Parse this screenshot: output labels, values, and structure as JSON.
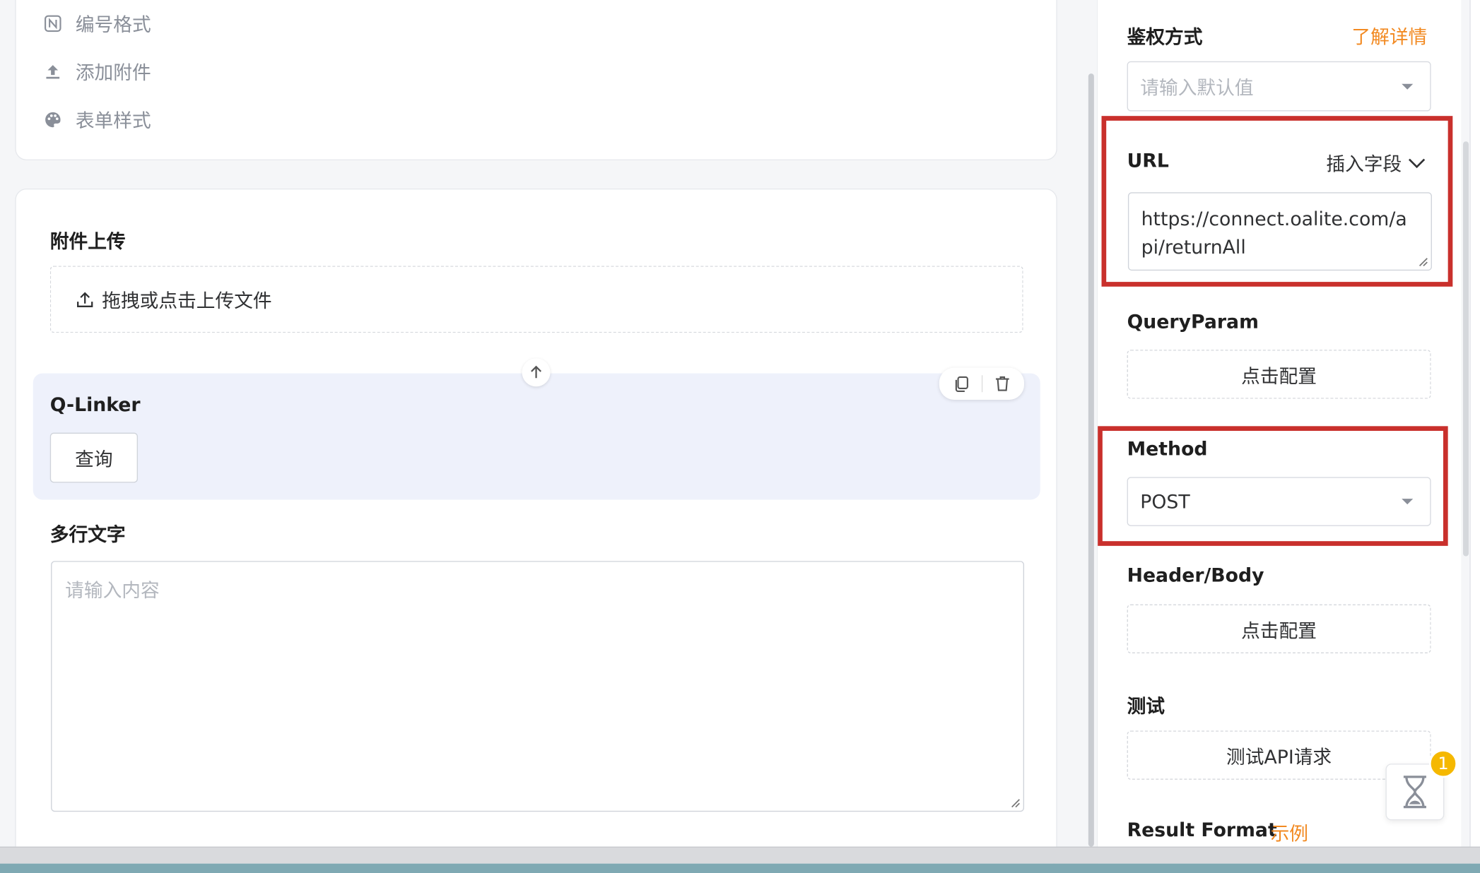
{
  "left_menu": {
    "items": [
      {
        "icon": "number-format-icon",
        "label": "编号格式"
      },
      {
        "icon": "upload-icon",
        "label": "添加附件"
      },
      {
        "icon": "palette-icon",
        "label": "表单样式"
      }
    ]
  },
  "form": {
    "attachment": {
      "title": "附件上传",
      "upload_label": "拖拽或点击上传文件"
    },
    "qlinker": {
      "title": "Q-Linker",
      "button_label": "查询"
    },
    "multiline": {
      "title": "多行文字",
      "placeholder": "请输入内容"
    }
  },
  "panel": {
    "auth": {
      "title": "鉴权方式",
      "link": "了解详情",
      "placeholder": "请输入默认值"
    },
    "url": {
      "title": "URL",
      "insert_field": "插入字段",
      "value": "https://connect.oalite.com/api/returnAll"
    },
    "query_param": {
      "title": "QueryParam",
      "button": "点击配置"
    },
    "method": {
      "title": "Method",
      "value": "POST"
    },
    "header_body": {
      "title": "Header/Body",
      "button": "点击配置"
    },
    "test": {
      "title": "测试",
      "button": "测试API请求"
    },
    "result_format": {
      "title": "Result Format",
      "link": "示例"
    }
  },
  "notification": {
    "count": "1"
  },
  "colors": {
    "accent": "#f28a22",
    "highlight": "#c9302c",
    "selected_bg": "#eef1fb",
    "badge": "#f5b800"
  }
}
